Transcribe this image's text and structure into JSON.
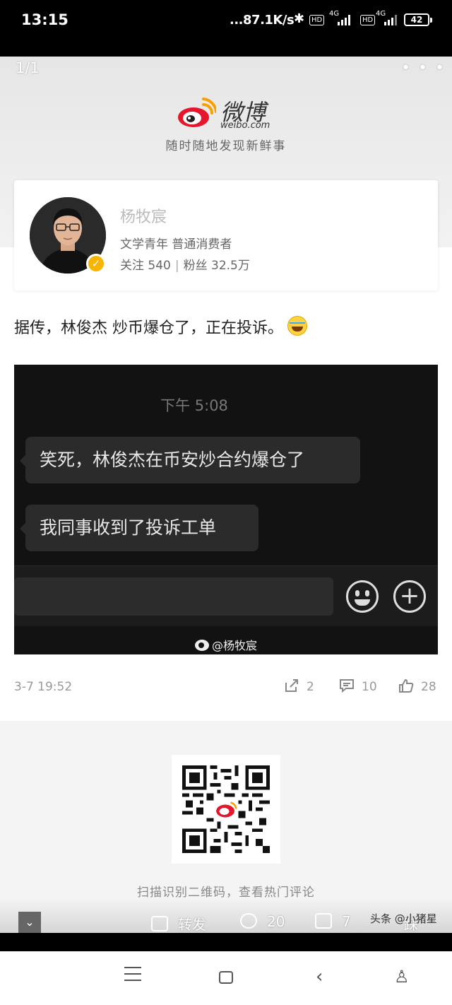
{
  "status_bar": {
    "time": "13:15",
    "network_speed": "...87.1K/s",
    "hd_badge": "HD",
    "signal_label": "4G",
    "battery": "42"
  },
  "viewer": {
    "page_indicator": "1/1",
    "more_menu": "• • •"
  },
  "brand": {
    "logo_cn": "微博",
    "logo_en": "weibo.com",
    "slogan": "随时随地发现新鲜事"
  },
  "profile": {
    "name": "杨牧宸",
    "description": "文学青年 普通消费者",
    "following_label": "关注",
    "following_count": "540",
    "followers_label": "粉丝",
    "followers_count": "32.5万"
  },
  "post": {
    "text": "据传，林俊杰 炒币爆仓了，正在投诉。",
    "emoji": "laugh-cry-emoji",
    "image": {
      "time": "下午 5:08",
      "messages": [
        {
          "text": "笑死，林俊杰在币安炒合约爆仓了"
        },
        {
          "text": "我同事收到了投诉工单"
        }
      ],
      "watermark": "@杨牧宸"
    },
    "date": "3-7 19:52",
    "reposts": "2",
    "comments": "10",
    "likes": "28"
  },
  "qr": {
    "tip": "扫描识别二维码，查看热门评论"
  },
  "bottom_actions": {
    "collapse": "⌄",
    "repost_label": "转发",
    "comments": "20",
    "likes": "7",
    "dislike_label": "踩"
  },
  "credit": "头条 @小猪星",
  "colors": {
    "weibo_red": "#e6162d",
    "verify_gold": "#f7b500",
    "chat_bg": "#121212"
  }
}
